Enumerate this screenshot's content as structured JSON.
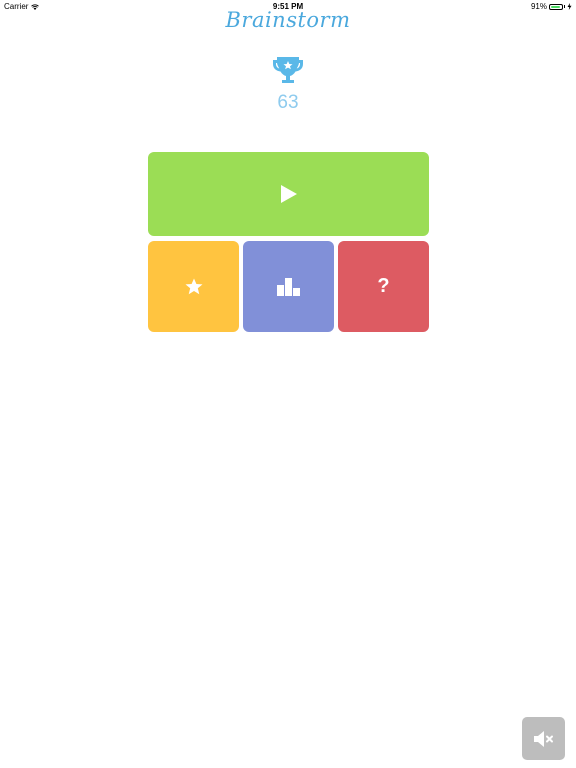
{
  "status_bar": {
    "carrier": "Carrier",
    "time": "9:51 PM",
    "battery_percent": "91%",
    "battery_level": 0.91,
    "icons": [
      "wifi-icon",
      "battery-icon",
      "charging-icon"
    ]
  },
  "header": {
    "logo_text": "Brainstorm"
  },
  "score": {
    "value": "63",
    "icon": "trophy-icon"
  },
  "menu": {
    "play": {
      "icon": "play-icon",
      "color": "#9bdd55"
    },
    "favorites": {
      "icon": "star-icon",
      "color": "#ffc440"
    },
    "rankings": {
      "icon": "podium-icon",
      "color": "#8190d8"
    },
    "help": {
      "icon": "question-icon",
      "glyph": "?",
      "color": "#dd5b62"
    }
  },
  "sound": {
    "icon": "speaker-muted-icon",
    "color": "#bdbdbd"
  },
  "colors": {
    "logo": "#4aa8dd",
    "trophy": "#5ab8e8",
    "score": "#8ecbee"
  }
}
